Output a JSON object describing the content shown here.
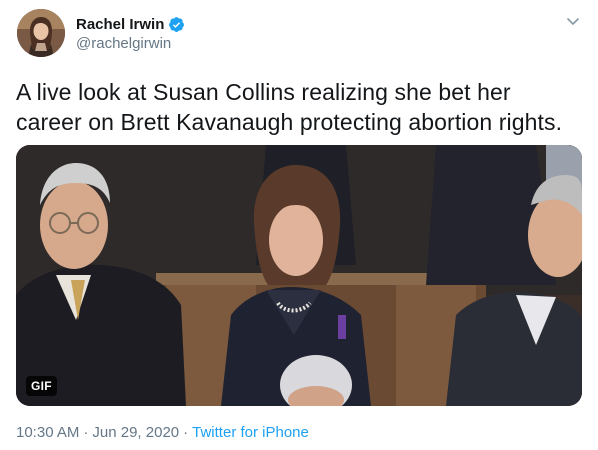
{
  "author": {
    "display_name": "Rachel Irwin",
    "handle": "@rachelgirwin",
    "verified": true,
    "avatar_icon": "profile-photo"
  },
  "menu_icon": "chevron-down-icon",
  "tweet": {
    "text": "A live look at Susan Collins realizing she bet her career on Brett Kavanaugh protecting abortion rights."
  },
  "media": {
    "type": "gif",
    "badge_label": "GIF"
  },
  "meta": {
    "time": "10:30 AM",
    "date": "Jun 29, 2020",
    "separator": "·",
    "source": "Twitter for iPhone"
  },
  "colors": {
    "link": "#1da1f2",
    "secondary_text": "#657786",
    "primary_text": "#14171a",
    "verified_badge": "#1da1f2"
  }
}
